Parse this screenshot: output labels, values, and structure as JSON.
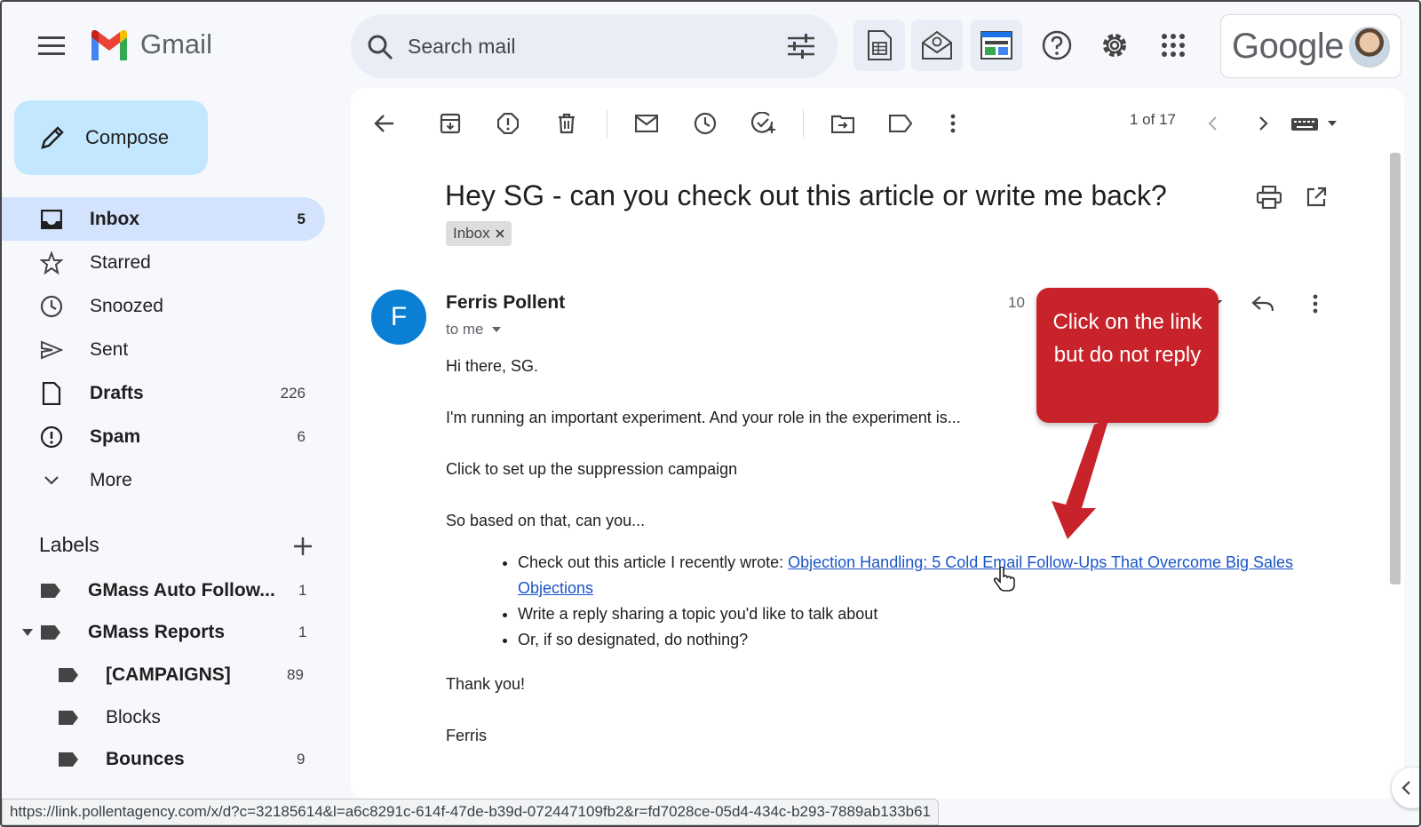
{
  "app": {
    "name": "Gmail",
    "brand": "Google"
  },
  "search": {
    "placeholder": "Search mail"
  },
  "compose": {
    "label": "Compose"
  },
  "sidebar": {
    "items": [
      {
        "label": "Inbox",
        "count": "5",
        "bold": true,
        "active": true,
        "icon": "inbox-icon"
      },
      {
        "label": "Starred",
        "count": "",
        "icon": "star-icon"
      },
      {
        "label": "Snoozed",
        "count": "",
        "icon": "clock-icon"
      },
      {
        "label": "Sent",
        "count": "",
        "icon": "send-icon"
      },
      {
        "label": "Drafts",
        "count": "226",
        "bold": true,
        "icon": "draft-icon"
      },
      {
        "label": "Spam",
        "count": "6",
        "bold": true,
        "icon": "spam-icon"
      },
      {
        "label": "More",
        "count": "",
        "icon": "chevron-down-icon"
      }
    ],
    "labels_title": "Labels",
    "labels": [
      {
        "label": "GMass Auto Follow...",
        "count": "1"
      },
      {
        "label": "GMass Reports",
        "count": "1"
      },
      {
        "label": "[CAMPAIGNS]",
        "count": "89"
      },
      {
        "label": "Blocks",
        "count": ""
      },
      {
        "label": "Bounces",
        "count": "9"
      }
    ]
  },
  "toolbar": {
    "pager": "1 of 17"
  },
  "email": {
    "subject": "Hey SG - can you check out this article or write me back?",
    "label_chip": "Inbox",
    "sender_initial": "F",
    "sender": "Ferris Pollent",
    "recipient": "to me",
    "date_fragment": "10",
    "greeting": "Hi there, SG.",
    "para1": "I'm running an important experiment. And your role in the experiment is...",
    "para2": "Click to set up the suppression campaign",
    "para3": "So based on that, can you...",
    "bullet1_prefix": "Check out this article I recently wrote: ",
    "bullet1_link": "Objection Handling: 5 Cold Email Follow-Ups That Overcome Big Sales Objections",
    "bullet2": "Write a reply sharing a topic you'd like to talk about",
    "bullet3": "Or, if so designated, do nothing?",
    "closing": "Thank you!",
    "signature": "Ferris"
  },
  "callout": {
    "text": "Click on the link but do not reply"
  },
  "status_bar": {
    "url": "https://link.pollentagency.com/x/d?c=32185614&l=a6c8291c-614f-47de-b39d-072447109fb2&r=fd7028ce-05d4-434c-b293-7889ab133b61"
  },
  "colors": {
    "compose": "#c2e7ff",
    "active_nav": "#d3e3fd",
    "link": "#1a55c8",
    "callout": "#c8232a",
    "avatar": "#0b7fd4"
  }
}
